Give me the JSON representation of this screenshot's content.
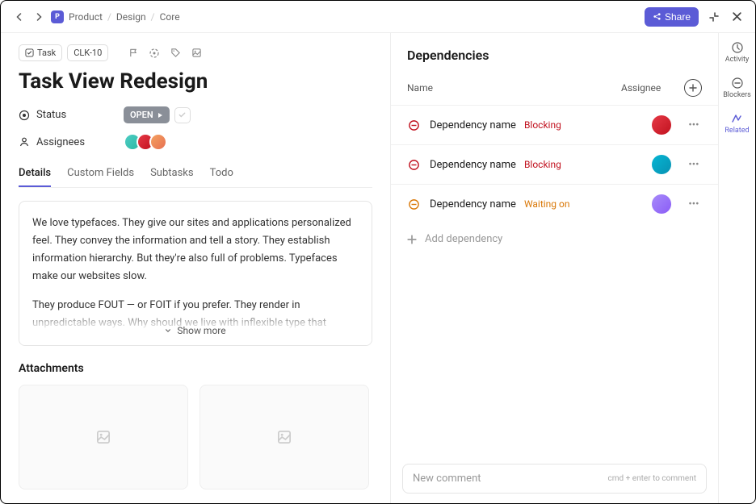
{
  "topbar": {
    "breadcrumb_icon_letter": "P",
    "breadcrumb": [
      "Product",
      "Design",
      "Core"
    ],
    "share_label": "Share"
  },
  "rail": {
    "activity": "Activity",
    "blockers": "Blockers",
    "related": "Related"
  },
  "task": {
    "badge": "Task",
    "id": "CLK-10",
    "title": "Task View Redesign",
    "status_label": "Status",
    "status_value": "OPEN",
    "assignees_label": "Assignees"
  },
  "tabs": {
    "details": "Details",
    "custom": "Custom Fields",
    "subtasks": "Subtasks",
    "todo": "Todo"
  },
  "description": {
    "p1": "We love typefaces. They give our sites and applications personalized feel. They convey the information and tell a story. They establish information hierarchy. But they're also full of problems. Typefaces make our websites slow.",
    "p2": "They produce FOUT — or FOIT if you prefer. They render in unpredictable ways. Why should we live with inflexible type that doesn't scale, when the",
    "show_more": "Show more"
  },
  "attachments": {
    "title": "Attachments"
  },
  "dependencies": {
    "title": "Dependencies",
    "col_name": "Name",
    "col_assignee": "Assignee",
    "rows": [
      {
        "name": "Dependency name",
        "tag": "Blocking",
        "tag_class": "tag-blocking",
        "status": "blocking",
        "avatar": "av2"
      },
      {
        "name": "Dependency name",
        "tag": "Blocking",
        "tag_class": "tag-blocking",
        "status": "blocking",
        "avatar": "av4"
      },
      {
        "name": "Dependency name",
        "tag": "Waiting on",
        "tag_class": "tag-waiting",
        "status": "waiting",
        "avatar": "av5"
      }
    ],
    "add_label": "Add dependency"
  },
  "comment": {
    "placeholder": "New comment",
    "hint": "cmd + enter to comment"
  }
}
